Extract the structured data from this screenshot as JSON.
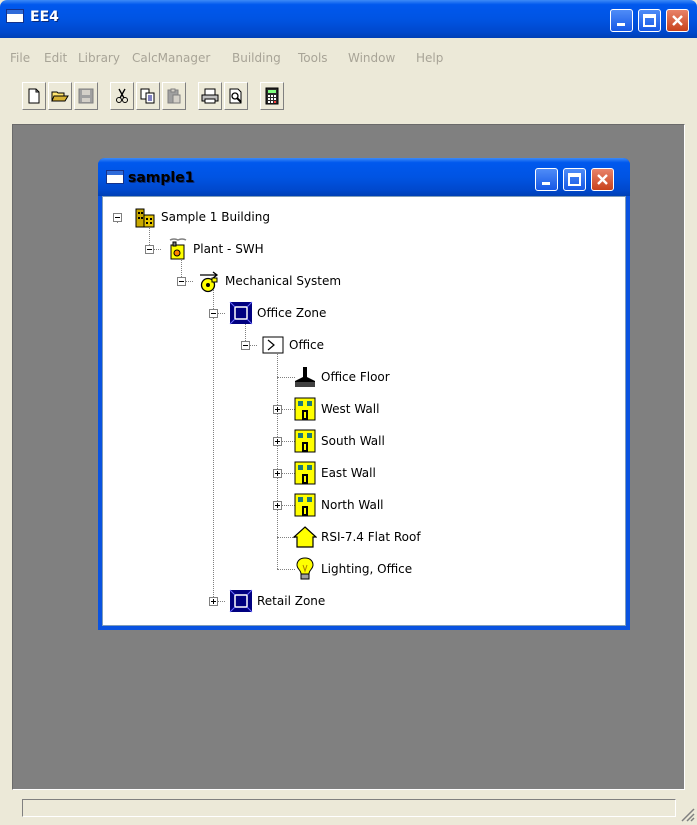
{
  "window": {
    "title": "EE4"
  },
  "menu": [
    "File",
    "Edit",
    "Library",
    "CalcManager",
    "Building",
    "Tools",
    "Window",
    "Help"
  ],
  "toolbar": [
    "new-icon",
    "open-icon",
    "save-icon",
    "cut-icon",
    "copy-icon",
    "paste-icon",
    "print-icon",
    "print-preview-icon",
    "calculator-icon"
  ],
  "child_window": {
    "title": "sample1"
  },
  "tree": [
    {
      "label": "Sample 1 Building",
      "icon": "building-icon",
      "depth": 0,
      "state": "expanded"
    },
    {
      "label": "Plant - SWH",
      "icon": "plant-icon",
      "depth": 1,
      "state": "expanded"
    },
    {
      "label": "Mechanical System",
      "icon": "fan-icon",
      "depth": 2,
      "state": "expanded"
    },
    {
      "label": "Office Zone",
      "icon": "zone-icon",
      "depth": 3,
      "state": "expanded"
    },
    {
      "label": "Office",
      "icon": "space-icon",
      "depth": 4,
      "state": "expanded"
    },
    {
      "label": "Office Floor",
      "icon": "floor-icon",
      "depth": 5,
      "state": "leaf"
    },
    {
      "label": "West Wall",
      "icon": "wall-icon",
      "depth": 5,
      "state": "collapsed"
    },
    {
      "label": "South Wall",
      "icon": "wall-icon",
      "depth": 5,
      "state": "collapsed"
    },
    {
      "label": "East Wall",
      "icon": "wall-icon",
      "depth": 5,
      "state": "collapsed"
    },
    {
      "label": "North Wall",
      "icon": "wall-icon",
      "depth": 5,
      "state": "collapsed"
    },
    {
      "label": "RSI-7.4 Flat Roof",
      "icon": "roof-icon",
      "depth": 5,
      "state": "leaf"
    },
    {
      "label": "Lighting, Office",
      "icon": "lightbulb-icon",
      "depth": 5,
      "state": "leaf"
    },
    {
      "label": "Retail Zone",
      "icon": "zone-icon",
      "depth": 3,
      "state": "collapsed"
    }
  ],
  "colors": {
    "titlebar": "#0054e3",
    "client_bg": "#808080",
    "icon_yellow": "#ffff00",
    "zone_blue": "#000080"
  }
}
